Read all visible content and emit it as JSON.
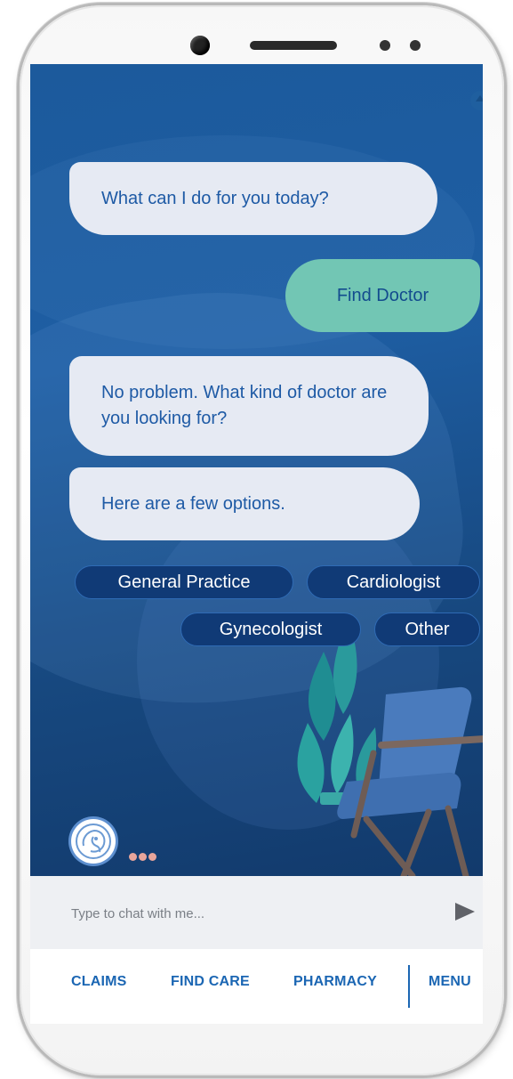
{
  "chat": {
    "messages": [
      {
        "role": "bot",
        "text": "What can I do for you today?"
      },
      {
        "role": "user",
        "text": "Find Doctor"
      },
      {
        "role": "bot",
        "text": "No problem. What kind of doctor are you looking for?"
      },
      {
        "role": "bot",
        "text": "Here are a few options."
      }
    ],
    "options": [
      "General Practice",
      "Cardiologist",
      "Gynecologist",
      "Other"
    ]
  },
  "input": {
    "placeholder": "Type to chat with me..."
  },
  "nav": {
    "items": [
      "CLAIMS",
      "FIND CARE",
      "PHARMACY",
      "MENU"
    ]
  },
  "icons": {
    "scroll_up": "arrow-up-icon",
    "send": "send-icon",
    "assistant_avatar": "assistant-avatar-icon",
    "typing": "typing-indicator-icon"
  },
  "colors": {
    "screen_background": "#1c5a9c",
    "bot_bubble": "#e6eaf3",
    "user_bubble": "#72c6b4",
    "chip_background": "#103a76",
    "accent_text": "#1b66b3"
  }
}
